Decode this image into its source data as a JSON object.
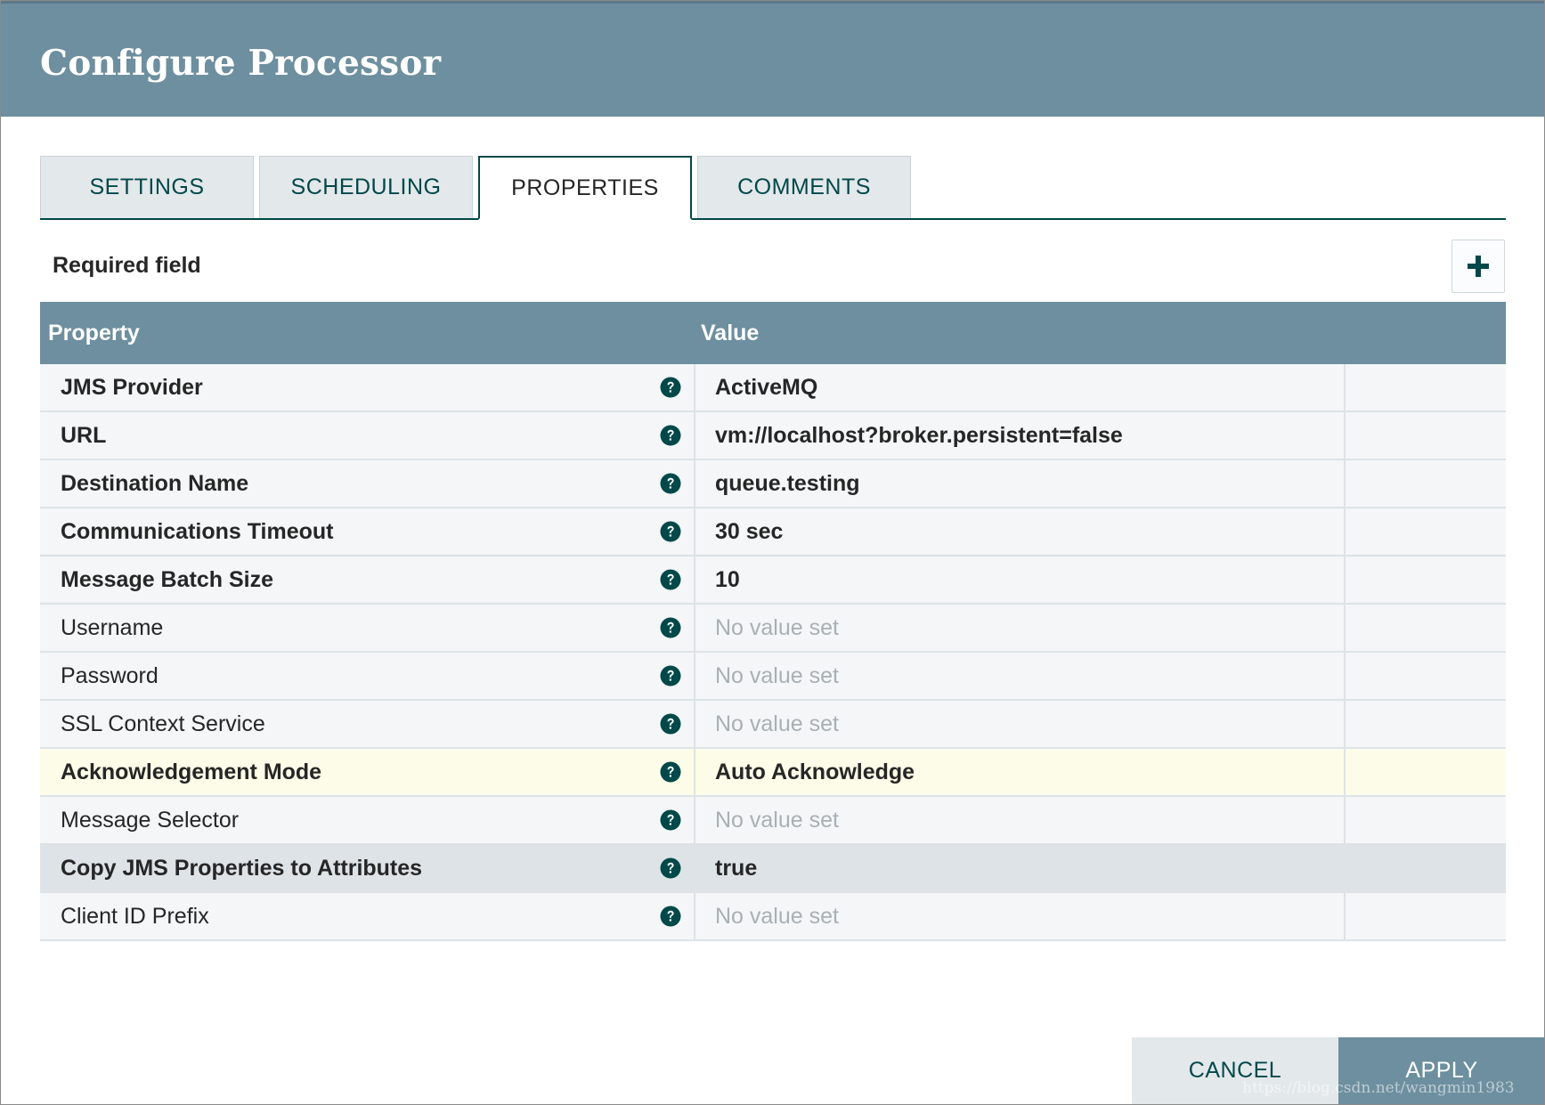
{
  "dialog": {
    "title": "Configure Processor"
  },
  "tabs": [
    {
      "label": "SETTINGS",
      "active": false
    },
    {
      "label": "SCHEDULING",
      "active": false
    },
    {
      "label": "PROPERTIES",
      "active": true
    },
    {
      "label": "COMMENTS",
      "active": false
    }
  ],
  "properties_panel": {
    "required_label": "Required field",
    "add_icon": "plus-icon",
    "columns": {
      "property": "Property",
      "value": "Value"
    },
    "help_icon": "question-circle-icon",
    "rows": [
      {
        "name": "JMS Provider",
        "value": "ActiveMQ",
        "required": true,
        "set": true,
        "state": "normal"
      },
      {
        "name": "URL",
        "value": "vm://localhost?broker.persistent=false",
        "required": true,
        "set": true,
        "state": "normal"
      },
      {
        "name": "Destination Name",
        "value": "queue.testing",
        "required": true,
        "set": true,
        "state": "normal"
      },
      {
        "name": "Communications Timeout",
        "value": "30 sec",
        "required": true,
        "set": true,
        "state": "normal"
      },
      {
        "name": "Message Batch Size",
        "value": "10",
        "required": true,
        "set": true,
        "state": "normal"
      },
      {
        "name": "Username",
        "value": "No value set",
        "required": false,
        "set": false,
        "state": "normal"
      },
      {
        "name": "Password",
        "value": "No value set",
        "required": false,
        "set": false,
        "state": "normal"
      },
      {
        "name": "SSL Context Service",
        "value": "No value set",
        "required": false,
        "set": false,
        "state": "normal"
      },
      {
        "name": "Acknowledgement Mode",
        "value": "Auto Acknowledge",
        "required": true,
        "set": true,
        "state": "highlight"
      },
      {
        "name": "Message Selector",
        "value": "No value set",
        "required": false,
        "set": false,
        "state": "normal"
      },
      {
        "name": "Copy JMS Properties to Attributes",
        "value": "true",
        "required": true,
        "set": true,
        "state": "selected"
      },
      {
        "name": "Client ID Prefix",
        "value": "No value set",
        "required": false,
        "set": false,
        "state": "normal"
      }
    ]
  },
  "footer": {
    "cancel_label": "CANCEL",
    "apply_label": "APPLY"
  },
  "watermark": "https://blog.csdn.net/wangmin1983",
  "colors": {
    "header": "#6d8f9f",
    "accent": "#004849",
    "highlight_row": "#fdfce8",
    "selected_row": "#dde3e7"
  }
}
